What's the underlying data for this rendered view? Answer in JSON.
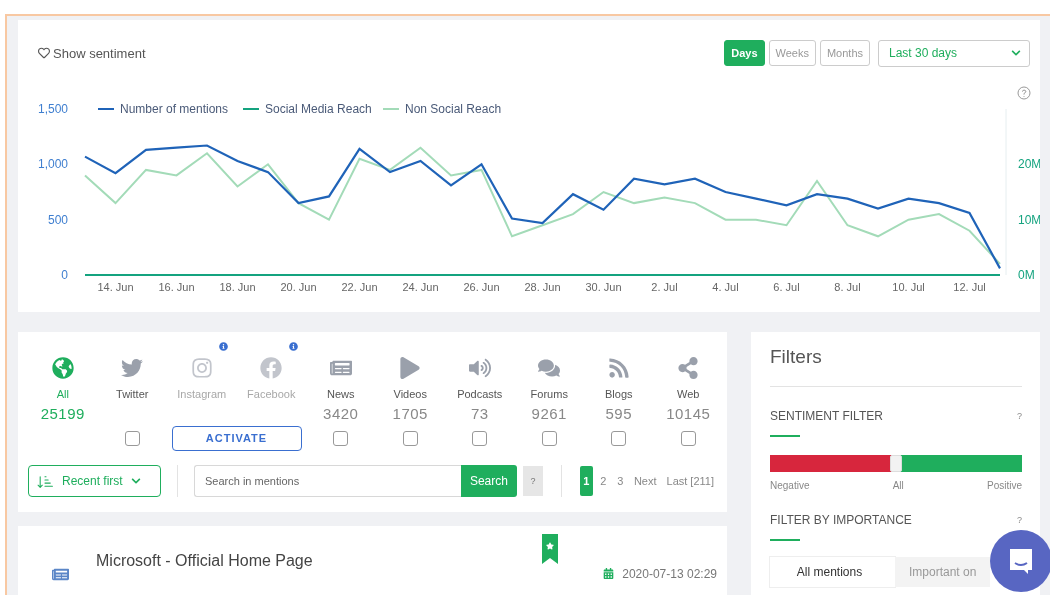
{
  "sentiment_toggle": {
    "label": "Show sentiment"
  },
  "period_tabs": [
    {
      "label": "Days",
      "selected": true
    },
    {
      "label": "Weeks",
      "selected": false
    },
    {
      "label": "Months",
      "selected": false
    }
  ],
  "range_select": {
    "value": "Last 30 days"
  },
  "chart": {
    "chart_data": {
      "type": "line",
      "categories": [
        null,
        "14. Jun",
        null,
        "16. Jun",
        null,
        "18. Jun",
        null,
        "20. Jun",
        null,
        "22. Jun",
        null,
        "24. Jun",
        null,
        "26. Jun",
        null,
        "28. Jun",
        null,
        "30. Jun",
        null,
        "2. Jul",
        null,
        "4. Jul",
        null,
        "6. Jul",
        null,
        "8. Jul",
        null,
        "10. Jul",
        null,
        "12. Jul",
        null
      ],
      "series": [
        {
          "name": "Number of mentions",
          "color": "#1f63b8",
          "values": [
            1070,
            920,
            1130,
            1150,
            1170,
            1030,
            930,
            650,
            710,
            1140,
            930,
            1030,
            810,
            1000,
            510,
            470,
            730,
            590,
            870,
            820,
            870,
            750,
            690,
            630,
            730,
            690,
            600,
            690,
            650,
            560,
            60
          ]
        },
        {
          "name": "Social Media Reach",
          "color": "#14a37f",
          "axis": "y2",
          "values": [
            0,
            0,
            0,
            0,
            0,
            0,
            0,
            0,
            0,
            0,
            0,
            0,
            0,
            0,
            0,
            0,
            0,
            0,
            0,
            0,
            0,
            0,
            0,
            0,
            0,
            0,
            0,
            0,
            0,
            0,
            0
          ]
        },
        {
          "name": "Non Social Reach",
          "color": "#a3dbb8",
          "axis": "y2",
          "values": [
            18,
            13,
            19,
            18,
            22,
            16,
            20,
            13,
            10,
            21,
            19,
            23,
            18,
            19,
            7,
            9,
            11,
            15,
            13,
            14,
            13,
            10,
            10,
            9,
            17,
            9,
            7,
            10,
            11,
            8,
            2
          ]
        }
      ],
      "ylim": [
        0,
        1500
      ],
      "yticks": [
        {
          "value": 0,
          "label": "0"
        },
        {
          "value": 500,
          "label": "500"
        },
        {
          "value": 1000,
          "label": "1,000"
        },
        {
          "value": 1500,
          "label": "1,500"
        }
      ],
      "y2ticks": [
        {
          "value": 0,
          "label": "0M"
        },
        {
          "value": 10,
          "label": "10M"
        },
        {
          "value": 20,
          "label": "20M"
        }
      ],
      "y2lim": [
        0,
        30
      ],
      "legend": "top"
    }
  },
  "sources": [
    {
      "label": "All",
      "count": "25199",
      "selected": true,
      "disabled": false
    },
    {
      "label": "Twitter",
      "selected": false,
      "disabled": false,
      "checked": false
    },
    {
      "label": "Instagram",
      "selected": false,
      "disabled": true,
      "info": true
    },
    {
      "label": "Facebook",
      "selected": false,
      "disabled": true,
      "info": true
    },
    {
      "label": "News",
      "count": "3420",
      "selected": false,
      "disabled": false,
      "checked": false
    },
    {
      "label": "Videos",
      "count": "1705",
      "selected": false,
      "disabled": false,
      "checked": false
    },
    {
      "label": "Podcasts",
      "count": "73",
      "selected": false,
      "disabled": false,
      "checked": false
    },
    {
      "label": "Forums",
      "count": "9261",
      "selected": false,
      "disabled": false,
      "checked": false
    },
    {
      "label": "Blogs",
      "count": "595",
      "selected": false,
      "disabled": false,
      "checked": false
    },
    {
      "label": "Web",
      "count": "10145",
      "selected": false,
      "disabled": false,
      "checked": false
    }
  ],
  "activate_button": "ACTIVATE",
  "sort_select": {
    "value": "Recent first"
  },
  "search": {
    "placeholder": "Search in mentions",
    "button": "Search",
    "help": "?"
  },
  "pagination": [
    {
      "label": "1",
      "selected": true
    },
    {
      "label": "2",
      "selected": false
    },
    {
      "label": "3",
      "selected": false
    },
    {
      "label": "Next",
      "selected": false
    },
    {
      "label": "Last [211]",
      "selected": false
    }
  ],
  "mention": {
    "title": "Microsoft - Official Home Page",
    "date": "2020-07-13 02:29"
  },
  "filters": {
    "title": "Filters",
    "sentiment": {
      "heading": "SENTIMENT FILTER",
      "help": "?",
      "level": 0.5,
      "labels": [
        "Negative",
        "All",
        "Positive"
      ]
    },
    "importance": {
      "heading": "FILTER BY IMPORTANCE",
      "help": "?",
      "options": [
        {
          "label": "All mentions",
          "selected": true
        },
        {
          "label": "Important on",
          "selected": false
        }
      ]
    }
  }
}
